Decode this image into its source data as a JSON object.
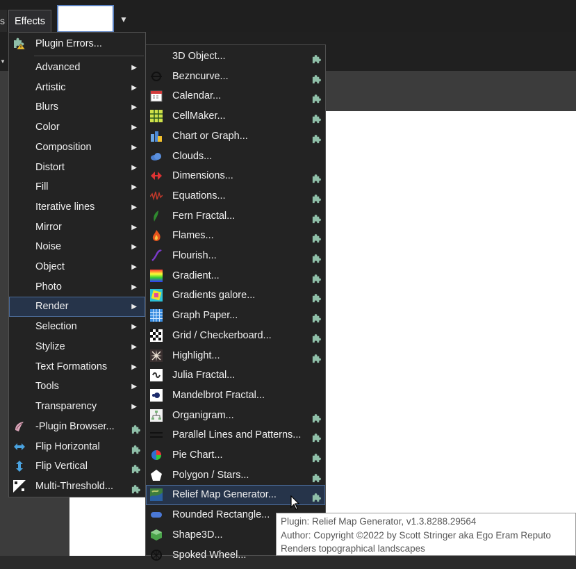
{
  "tabs": {
    "prev": "s",
    "effects": "Effects"
  },
  "menu": {
    "plugin_errors": "Plugin Errors...",
    "categories": [
      "Advanced",
      "Artistic",
      "Blurs",
      "Color",
      "Composition",
      "Distort",
      "Fill",
      "Iterative lines",
      "Mirror",
      "Noise",
      "Object",
      "Photo",
      "Render",
      "Selection",
      "Stylize",
      "Text Formations",
      "Tools",
      "Transparency"
    ],
    "highlighted": "Render",
    "extras": [
      {
        "label": "-Plugin Browser...",
        "icon": "plugin-browser-icon"
      },
      {
        "label": "Flip Horizontal",
        "icon": "flip-horizontal-icon"
      },
      {
        "label": "Flip Vertical",
        "icon": "flip-vertical-icon"
      },
      {
        "label": "Multi-Threshold...",
        "icon": "multi-threshold-icon"
      }
    ]
  },
  "render_menu": {
    "items": [
      {
        "label": "3D Object...",
        "icon": "none",
        "plugin": true
      },
      {
        "label": "Bezncurve...",
        "icon": "bezier-curve-icon",
        "plugin": true
      },
      {
        "label": "Calendar...",
        "icon": "calendar-icon",
        "plugin": true
      },
      {
        "label": "CellMaker...",
        "icon": "cell-grid-icon",
        "plugin": true
      },
      {
        "label": "Chart or Graph...",
        "icon": "chart-icon",
        "plugin": true
      },
      {
        "label": "Clouds...",
        "icon": "clouds-icon",
        "plugin": false
      },
      {
        "label": "Dimensions...",
        "icon": "dimensions-icon",
        "plugin": true
      },
      {
        "label": "Equations...",
        "icon": "equations-icon",
        "plugin": true
      },
      {
        "label": "Fern Fractal...",
        "icon": "fern-icon",
        "plugin": true
      },
      {
        "label": "Flames...",
        "icon": "flame-icon",
        "plugin": true
      },
      {
        "label": "Flourish...",
        "icon": "flourish-icon",
        "plugin": true
      },
      {
        "label": "Gradient...",
        "icon": "gradient-icon",
        "plugin": true
      },
      {
        "label": "Gradients galore...",
        "icon": "gradients-galore-icon",
        "plugin": true
      },
      {
        "label": "Graph Paper...",
        "icon": "graph-paper-icon",
        "plugin": true
      },
      {
        "label": "Grid / Checkerboard...",
        "icon": "checkerboard-icon",
        "plugin": true
      },
      {
        "label": "Highlight...",
        "icon": "highlight-icon",
        "plugin": true
      },
      {
        "label": "Julia Fractal...",
        "icon": "julia-fractal-icon",
        "plugin": false
      },
      {
        "label": "Mandelbrot Fractal...",
        "icon": "mandelbrot-icon",
        "plugin": false
      },
      {
        "label": "Organigram...",
        "icon": "organigram-icon",
        "plugin": true
      },
      {
        "label": "Parallel Lines and Patterns...",
        "icon": "parallel-lines-icon",
        "plugin": true
      },
      {
        "label": "Pie Chart...",
        "icon": "pie-chart-icon",
        "plugin": true
      },
      {
        "label": "Polygon / Stars...",
        "icon": "polygon-icon",
        "plugin": true
      },
      {
        "label": "Relief Map Generator...",
        "icon": "relief-map-icon",
        "plugin": true
      },
      {
        "label": "Rounded Rectangle...",
        "icon": "rounded-rectangle-icon",
        "plugin": false
      },
      {
        "label": "Shape3D...",
        "icon": "shape3d-icon",
        "plugin": false
      },
      {
        "label": "Spoked Wheel...",
        "icon": "spoked-wheel-icon",
        "plugin": false
      }
    ],
    "highlighted": "Relief Map Generator..."
  },
  "tooltip": {
    "line1": "Plugin: Relief Map Generator, v1.3.8288.29564",
    "line2": "Author: Copyright ©2022 by Scott Stringer aka Ego Eram Reputo",
    "line3": "Renders topographical landscapes"
  },
  "colors": {
    "menu_bg": "#232323",
    "highlight": "#26344a",
    "puzzle": "#8fbfa8",
    "accent": "#4b6b98"
  }
}
